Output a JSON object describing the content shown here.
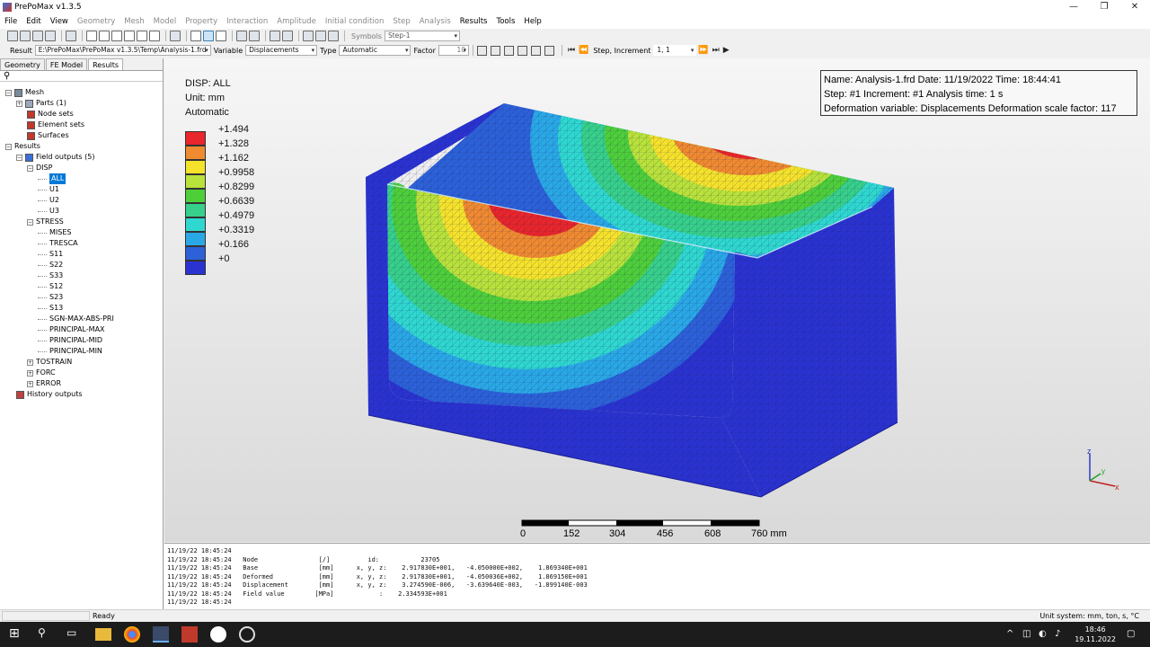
{
  "window": {
    "title": "PrePoMax v1.3.5"
  },
  "menu": [
    {
      "label": "File",
      "enabled": true
    },
    {
      "label": "Edit",
      "enabled": true
    },
    {
      "label": "View",
      "enabled": true
    },
    {
      "label": "Geometry",
      "enabled": false
    },
    {
      "label": "Mesh",
      "enabled": false
    },
    {
      "label": "Model",
      "enabled": false
    },
    {
      "label": "Property",
      "enabled": false
    },
    {
      "label": "Interaction",
      "enabled": false
    },
    {
      "label": "Amplitude",
      "enabled": false
    },
    {
      "label": "Initial condition",
      "enabled": false
    },
    {
      "label": "Step",
      "enabled": false
    },
    {
      "label": "Analysis",
      "enabled": false
    },
    {
      "label": "Results",
      "enabled": true
    },
    {
      "label": "Tools",
      "enabled": true
    },
    {
      "label": "Help",
      "enabled": true
    }
  ],
  "toolbar": {
    "symbols_label": "Symbols",
    "symbols_value": "Step-1"
  },
  "results_bar": {
    "result_label": "Result",
    "result_path": "E:\\PrePoMax\\PrePoMax v1.3.5\\Temp\\Analysis-1.frd",
    "variable_label": "Variable",
    "variable_value": "Displacements",
    "type_label": "Type",
    "type_value": "Automatic",
    "factor_label": "Factor",
    "factor_value": "10",
    "step_label": "Step, Increment",
    "step_value": "1, 1"
  },
  "tabs": [
    {
      "label": "Geometry"
    },
    {
      "label": "FE Model"
    },
    {
      "label": "Results"
    }
  ],
  "tree": {
    "mesh": "Mesh",
    "parts": "Parts (1)",
    "node_sets": "Node sets",
    "element_sets": "Element sets",
    "surfaces": "Surfaces",
    "results": "Results",
    "field_outputs": "Field outputs (5)",
    "disp": "DISP",
    "disp_items": [
      "ALL",
      "U1",
      "U2",
      "U3"
    ],
    "stress": "STRESS",
    "stress_items": [
      "MISES",
      "TRESCA",
      "S11",
      "S22",
      "S33",
      "S12",
      "S23",
      "S13",
      "SGN-MAX-ABS-PRI",
      "PRINCIPAL-MAX",
      "PRINCIPAL-MID",
      "PRINCIPAL-MIN"
    ],
    "others": [
      "TOSTRAIN",
      "FORC",
      "ERROR"
    ],
    "history_outputs": "History outputs"
  },
  "legend": {
    "title": "DISP: ALL",
    "unit": "Unit: mm",
    "mode": "Automatic",
    "values": [
      "+1.494",
      "+1.328",
      "+1.162",
      "+0.9958",
      "+0.8299",
      "+0.6639",
      "+0.4979",
      "+0.3319",
      "+0.166",
      "+0"
    ],
    "colors": [
      "#e8262b",
      "#f08a30",
      "#f5e22a",
      "#b9e23a",
      "#4ecf3a",
      "#37d08a",
      "#2fd8cf",
      "#2aa8e6",
      "#2c61d8",
      "#2a33d0"
    ]
  },
  "info": {
    "line1": "Name: Analysis-1.frd   Date: 11/19/2022   Time: 18:44:41",
    "line2": "Step: #1   Increment: #1   Analysis time: 1 s",
    "line3": "Deformation variable: Displacements   Deformation scale factor: 117"
  },
  "scale_bar": {
    "labels": [
      "0",
      "152",
      "304",
      "456",
      "608",
      "760 mm"
    ]
  },
  "axes": {
    "z": "z",
    "y": "y",
    "x": "x"
  },
  "console": {
    "lines": [
      "11/19/22 18:45:24",
      "11/19/22 18:45:24   Node                [/]          id:           23705",
      "11/19/22 18:45:24   Base                [mm]      x, y, z:    2.917830E+001,   -4.050000E+002,    1.869340E+001",
      "11/19/22 18:45:24   Deformed            [mm]      x, y, z:    2.917830E+001,   -4.050036E+002,    1.869150E+001",
      "11/19/22 18:45:24   Displacement        [mm]      x, y, z:    3.274590E-006,   -3.639640E-003,   -1.899140E-003",
      "11/19/22 18:45:24   Field value        [MPa]            :    2.334593E+001",
      "11/19/22 18:45:24"
    ]
  },
  "status": {
    "ready": "Ready",
    "unit_system": "Unit system: mm, ton, s, °C"
  },
  "taskbar": {
    "time": "18:46",
    "date": "19.11.2022"
  }
}
